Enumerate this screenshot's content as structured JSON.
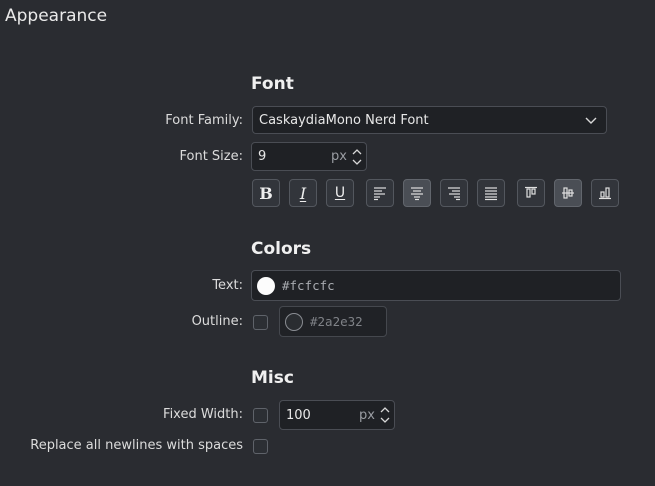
{
  "header": {
    "title": "Appearance"
  },
  "font": {
    "section_title": "Font",
    "family_label": "Font Family:",
    "family_value": "CaskaydiaMono Nerd Font",
    "size_label": "Font Size:",
    "size_value": "9",
    "size_unit": "px",
    "toolbar": [
      {
        "name": "bold-button",
        "icon": "bold-icon",
        "glyph": "B",
        "active": false
      },
      {
        "name": "italic-button",
        "icon": "italic-icon",
        "glyph": "I",
        "active": false
      },
      {
        "name": "underline-button",
        "icon": "underline-icon",
        "glyph": "U",
        "active": false
      },
      {
        "name": "align-left-button",
        "icon": "align-left-icon",
        "active": false
      },
      {
        "name": "align-center-button",
        "icon": "align-center-icon",
        "active": true
      },
      {
        "name": "align-right-button",
        "icon": "align-right-icon",
        "active": false
      },
      {
        "name": "align-justify-button",
        "icon": "align-justify-icon",
        "active": false
      },
      {
        "name": "valign-top-button",
        "icon": "valign-top-icon",
        "active": false
      },
      {
        "name": "valign-center-button",
        "icon": "valign-center-icon",
        "active": true
      },
      {
        "name": "valign-bottom-button",
        "icon": "valign-bottom-icon",
        "active": false
      }
    ]
  },
  "colors": {
    "section_title": "Colors",
    "text_label": "Text:",
    "text_color": "#fcfcfc",
    "outline_label": "Outline:",
    "outline_checked": false,
    "outline_color": "#2a2e32"
  },
  "misc": {
    "section_title": "Misc",
    "fixed_width_label": "Fixed Width:",
    "fixed_width_checked": false,
    "fixed_width_value": "100",
    "fixed_width_unit": "px",
    "newlines_label": "Replace all newlines with spaces",
    "newlines_checked": false
  }
}
